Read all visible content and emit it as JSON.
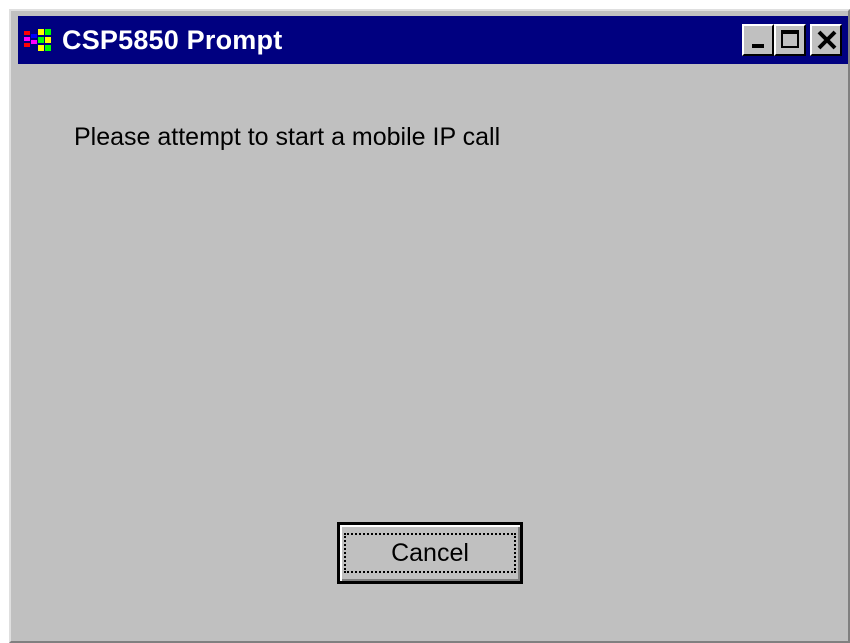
{
  "window": {
    "title": "CSP5850 Prompt",
    "icon": "application-icon",
    "controls": {
      "minimize": "minimize-icon",
      "maximize": "maximize-icon",
      "close": "close-icon"
    }
  },
  "content": {
    "message": "Please attempt to start a mobile IP call"
  },
  "buttons": {
    "cancel_label": "Cancel"
  },
  "colors": {
    "titlebar": "#000080",
    "window_face": "#c0c0c0",
    "title_text": "#ffffff"
  }
}
